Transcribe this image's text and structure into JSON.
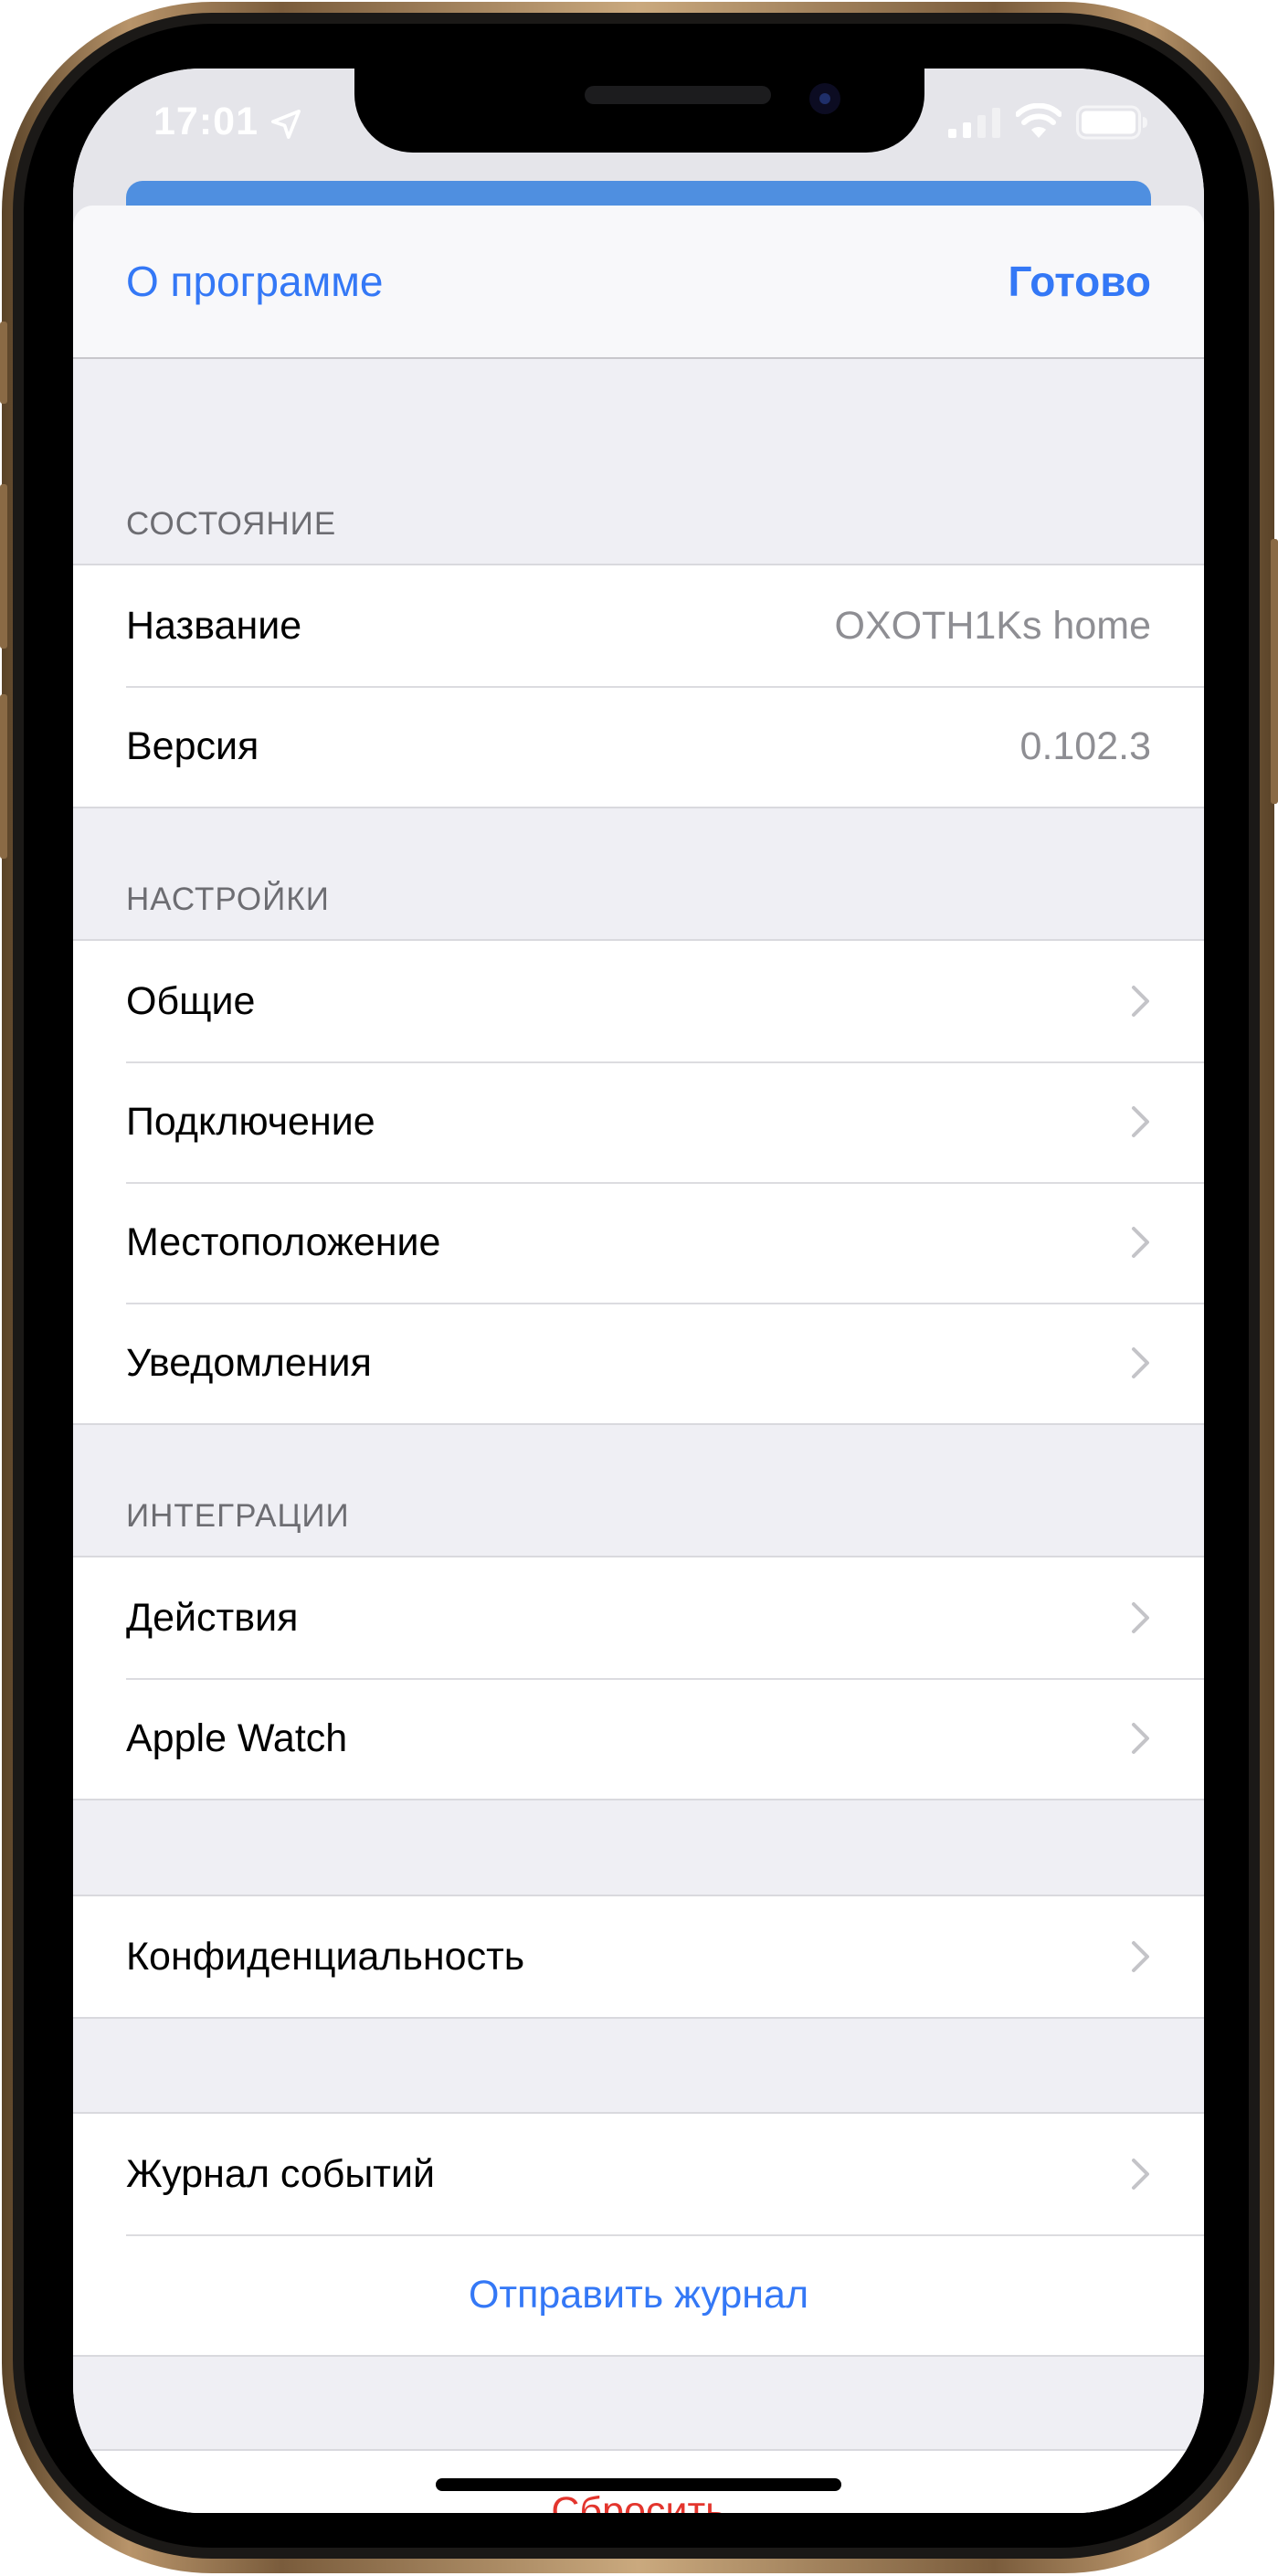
{
  "status_bar": {
    "time": "17:01",
    "location_icon": "location-arrow-icon",
    "signal_icon": "cellular-signal-icon",
    "wifi_icon": "wifi-icon",
    "battery_icon": "battery-icon"
  },
  "nav": {
    "back_label": "О программе",
    "done_label": "Готово"
  },
  "sections": {
    "status": {
      "header": "СОСТОЯНИЕ",
      "rows": [
        {
          "label": "Название",
          "value": "OXOTH1Ks home"
        },
        {
          "label": "Версия",
          "value": "0.102.3"
        }
      ]
    },
    "settings": {
      "header": "НАСТРОЙКИ",
      "rows": [
        {
          "label": "Общие"
        },
        {
          "label": "Подключение"
        },
        {
          "label": "Местоположение"
        },
        {
          "label": "Уведомления"
        }
      ]
    },
    "integrations": {
      "header": "ИНТЕГРАЦИИ",
      "rows": [
        {
          "label": "Действия"
        },
        {
          "label": "Apple Watch"
        }
      ]
    },
    "privacy": {
      "rows": [
        {
          "label": "Конфиденциальность"
        }
      ]
    },
    "log": {
      "rows": [
        {
          "label": "Журнал событий"
        }
      ],
      "send_label": "Отправить журнал"
    },
    "reset": {
      "label": "Сбросить"
    }
  },
  "colors": {
    "accent": "#3478f6",
    "destructive": "#e3352d",
    "background": "#efeff4",
    "secondary_text": "#8e8e93"
  }
}
